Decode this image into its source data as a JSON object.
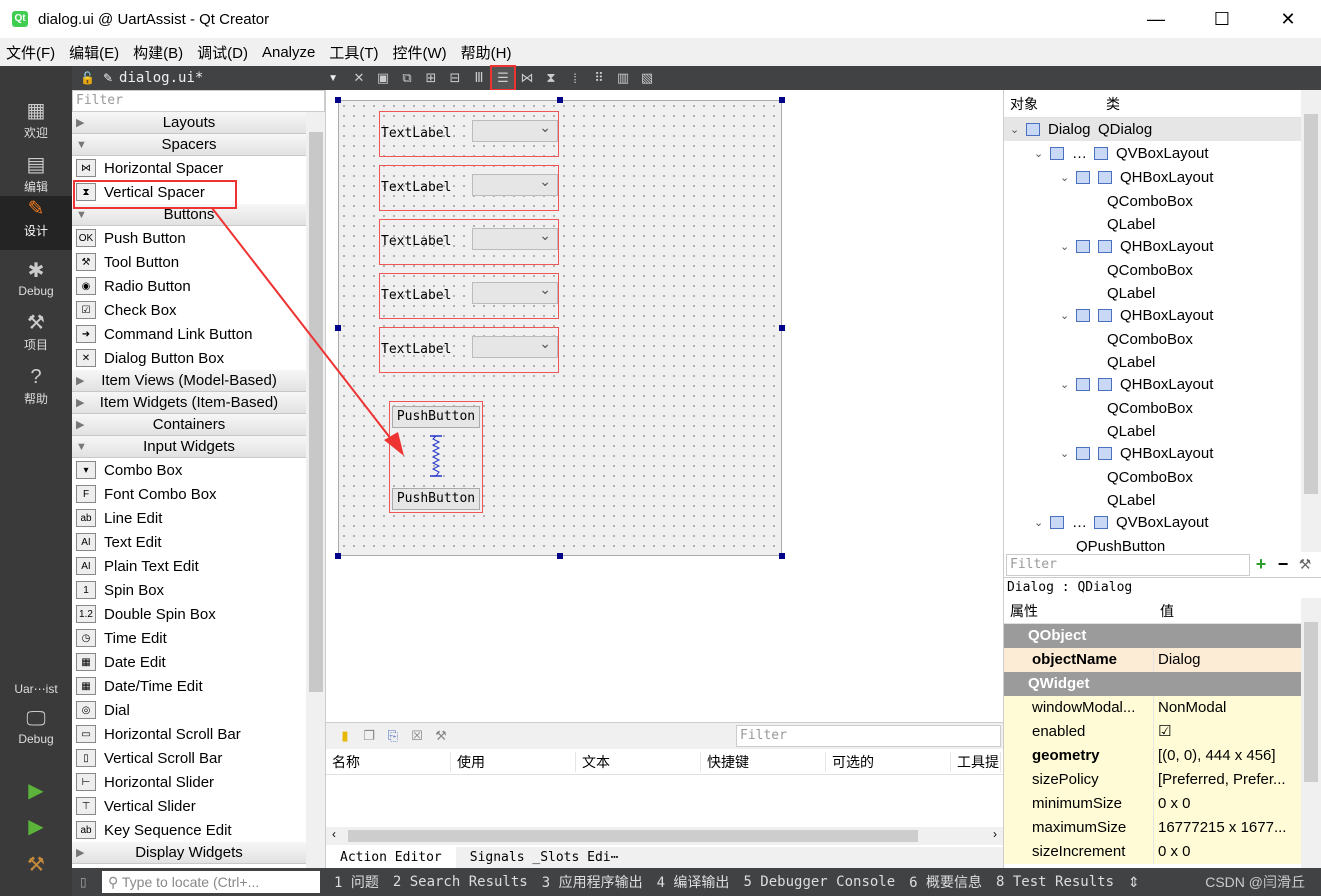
{
  "window": {
    "title": "dialog.ui @ UartAssist - Qt Creator",
    "min": "—",
    "max": "☐",
    "close": "✕"
  },
  "menu": [
    "文件(F)",
    "编辑(E)",
    "构建(B)",
    "调试(D)",
    "Analyze",
    "工具(T)",
    "控件(W)",
    "帮助(H)"
  ],
  "sidebar": {
    "items": [
      {
        "label": "欢迎",
        "icon": "grid-icon"
      },
      {
        "label": "编辑",
        "icon": "document-icon"
      },
      {
        "label": "设计",
        "icon": "pencil-icon"
      },
      {
        "label": "Debug",
        "icon": "bug-icon"
      },
      {
        "label": "项目",
        "icon": "wrench-icon"
      },
      {
        "label": "帮助",
        "icon": "help-icon"
      }
    ],
    "target": "Uar⋯ist",
    "target_mode": "Debug"
  },
  "editor_tab": {
    "file": "dialog.ui*"
  },
  "widgetbox": {
    "filter": "Filter",
    "sections": [
      {
        "title": "Layouts",
        "items": []
      },
      {
        "title": "Spacers",
        "items": [
          "Horizontal Spacer",
          "Vertical Spacer"
        ]
      },
      {
        "title": "Buttons",
        "items": [
          "Push Button",
          "Tool Button",
          "Radio Button",
          "Check Box",
          "Command Link Button",
          "Dialog Button Box"
        ]
      },
      {
        "title": "Item Views (Model-Based)",
        "items": []
      },
      {
        "title": "Item Widgets (Item-Based)",
        "items": []
      },
      {
        "title": "Containers",
        "items": []
      },
      {
        "title": "Input Widgets",
        "items": [
          "Combo Box",
          "Font Combo Box",
          "Line Edit",
          "Text Edit",
          "Plain Text Edit",
          "Spin Box",
          "Double Spin Box",
          "Time Edit",
          "Date Edit",
          "Date/Time Edit",
          "Dial",
          "Horizontal Scroll Bar",
          "Vertical Scroll Bar",
          "Horizontal Slider",
          "Vertical Slider",
          "Key Sequence Edit"
        ]
      },
      {
        "title": "Display Widgets",
        "items": []
      }
    ]
  },
  "form": {
    "labels": [
      "TextLabel",
      "TextLabel",
      "TextLabel",
      "TextLabel",
      "TextLabel"
    ],
    "button1": "PushButton",
    "button2": "PushButton"
  },
  "action_editor": {
    "filter": "Filter",
    "columns": [
      "名称",
      "使用",
      "文本",
      "快捷键",
      "可选的",
      "工具提"
    ],
    "tabs": [
      "Action Editor",
      "Signals _Slots Edi⋯"
    ]
  },
  "object_inspector": {
    "columns": [
      "对象",
      "类"
    ],
    "rows": [
      {
        "obj": "Dialog",
        "cls": "QDialog"
      },
      {
        "obj": "…",
        "cls": "QVBoxLayout"
      },
      {
        "obj": "",
        "cls": "QHBoxLayout"
      },
      {
        "obj": "",
        "cls": "QComboBox"
      },
      {
        "obj": "",
        "cls": "QLabel"
      },
      {
        "obj": "",
        "cls": "QHBoxLayout"
      },
      {
        "obj": "",
        "cls": "QComboBox"
      },
      {
        "obj": "",
        "cls": "QLabel"
      },
      {
        "obj": "",
        "cls": "QHBoxLayout"
      },
      {
        "obj": "",
        "cls": "QComboBox"
      },
      {
        "obj": "",
        "cls": "QLabel"
      },
      {
        "obj": "",
        "cls": "QHBoxLayout"
      },
      {
        "obj": "",
        "cls": "QComboBox"
      },
      {
        "obj": "",
        "cls": "QLabel"
      },
      {
        "obj": "",
        "cls": "QHBoxLayout"
      },
      {
        "obj": "",
        "cls": "QComboBox"
      },
      {
        "obj": "",
        "cls": "QLabel"
      },
      {
        "obj": "…",
        "cls": "QVBoxLayout"
      },
      {
        "obj": "…",
        "cls": "QPushButton"
      }
    ]
  },
  "property_editor": {
    "filter": "Filter",
    "class_line": "Dialog : QDialog",
    "columns": [
      "属性",
      "值"
    ],
    "sections": [
      {
        "title": "QObject",
        "rows": [
          {
            "name": "objectName",
            "value": "Dialog"
          }
        ]
      },
      {
        "title": "QWidget",
        "rows": [
          {
            "name": "windowModal...",
            "value": "NonModal"
          },
          {
            "name": "enabled",
            "value": "☑"
          },
          {
            "name": "geometry",
            "value": "[(0, 0), 444 x 456]"
          },
          {
            "name": "sizePolicy",
            "value": "[Preferred, Prefer..."
          },
          {
            "name": "minimumSize",
            "value": "0 x 0"
          },
          {
            "name": "maximumSize",
            "value": "16777215 x 1677..."
          },
          {
            "name": "sizeIncrement",
            "value": "0 x 0"
          }
        ]
      }
    ]
  },
  "statusbar": {
    "locator": "Type to locate (Ctrl+...",
    "items": [
      "1 问题",
      "2 Search Results",
      "3 应用程序输出",
      "4 编译输出",
      "5 Debugger Console",
      "6 概要信息",
      "8 Test Results"
    ],
    "watermark": "CSDN @闫滑丘"
  }
}
